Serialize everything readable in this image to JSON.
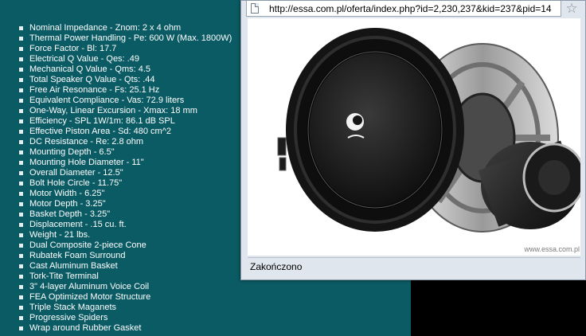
{
  "specs": [
    "Nominal Impedance - Znom: 2 x 4 ohm",
    "Thermal Power Handling - Pe: 600 W (Max. 1800W)",
    "Force Factor - Bl: 17.7",
    "Electrical Q Value - Qes: .49",
    "Mechanical Q Value - Qms: 4.5",
    "Total Speaker Q Value - Qts: .44",
    "Free Air Resonance - Fs: 25.1 Hz",
    "Equivalent Compliance - Vas: 72.9 liters",
    "One-Way, Linear Excursion - Xmax: 18 mm",
    "Efficiency - SPL 1W/1m: 86.1 dB SPL",
    "Effective Piston Area - Sd: 480 cm^2",
    "DC Resistance - Re: 2.8 ohm",
    "Mounting Depth - 6.5\"",
    "Mounting Hole Diameter - 11\"",
    "Overall Diameter - 12.5\"",
    "Bolt Hole Circle - 11.75\"",
    "Motor Width - 6.25\"",
    "Motor Depth - 3.25\"",
    "Basket Depth - 3.25\"",
    "Displacement - .15 cu. ft.",
    "Weight - 21 lbs.",
    "Dual Composite 2-piece Cone",
    "Rubatek Foam Surround",
    "Cast Aluminum Basket",
    "Tork-Tite Terminal",
    "3\" 4-layer Aluminum Voice Coil",
    "FEA Optimized Motor Structure",
    "Triple Stack Maganets",
    "Progressive Spiders",
    "Wrap around Rubber Gasket"
  ],
  "popup": {
    "url": "http://essa.com.pl/oferta/index.php?id=2,230,237&kid=237&pid=14",
    "status": "Zakończono",
    "watermark": "www.essa.com.pl"
  },
  "colors": {
    "panel_bg": "#0b5b64",
    "desktop_bg": "#000000",
    "popup_chrome": "#dfe6ee"
  },
  "icons": {
    "page": "page-icon",
    "bookmark": "star-icon",
    "bullet": "square-bullet"
  }
}
